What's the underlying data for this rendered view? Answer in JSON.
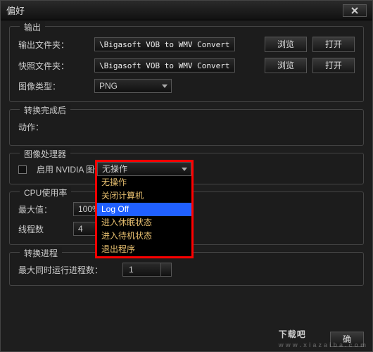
{
  "window": {
    "title": "偏好"
  },
  "output": {
    "group_title": "输出",
    "output_folder_label": "输出文件夹：",
    "output_folder_value": "\\Bigasoft VOB to WMV Converter",
    "snapshot_folder_label": "快照文件夹：",
    "snapshot_folder_value": "\\Bigasoft VOB to WMV Converter",
    "image_type_label": "图像类型：",
    "image_type_value": "PNG",
    "browse": "浏览",
    "open": "打开"
  },
  "after_convert": {
    "group_title": "转换完成后",
    "action_label": "动作：",
    "selected": "无操作",
    "options": [
      "无操作",
      "关闭计算机",
      "Log Off",
      "进入休眠状态",
      "进入待机状态",
      "退出程序"
    ],
    "highlight_index": 2
  },
  "gpu": {
    "group_title": "图像处理器",
    "enable_label": "启用 NVIDIA 图像"
  },
  "cpu": {
    "group_title": "CPU使用率",
    "max_label": "最大值：",
    "max_value": "100%",
    "threads_label": "线程数",
    "threads_value": "4"
  },
  "progress": {
    "group_title": "转换进程",
    "max_concurrent_label": "最大同时运行进程数：",
    "max_concurrent_value": "1"
  },
  "footer": {
    "ok": "确"
  },
  "watermark": {
    "main": "下载吧",
    "sub": "www.xiazaiba.com"
  }
}
